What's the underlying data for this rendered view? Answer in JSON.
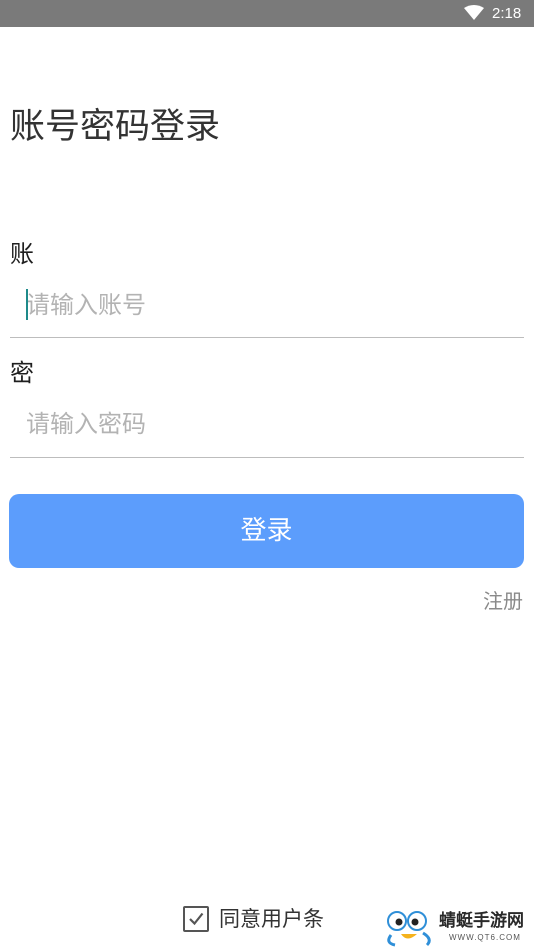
{
  "status_bar": {
    "time": "2:18",
    "wifi_icon": "wifi-icon"
  },
  "page": {
    "title": "账号密码登录"
  },
  "form": {
    "account_label": "账",
    "account_placeholder": "请输入账号",
    "account_value": "",
    "password_label": "密",
    "password_placeholder": "请输入密码",
    "password_value": "",
    "login_label": "登录",
    "register_label": "注册"
  },
  "agreement": {
    "checked": true,
    "text": "同意用户条",
    "checkbox_icon": "checkmark-icon"
  },
  "watermark": {
    "name": "蜻蜓手游网",
    "url": "WWW.QT6.COM"
  },
  "colors": {
    "status_bar": "#7a7a7a",
    "primary_button": "#5c9dfc",
    "caret": "#1e8a8a"
  }
}
